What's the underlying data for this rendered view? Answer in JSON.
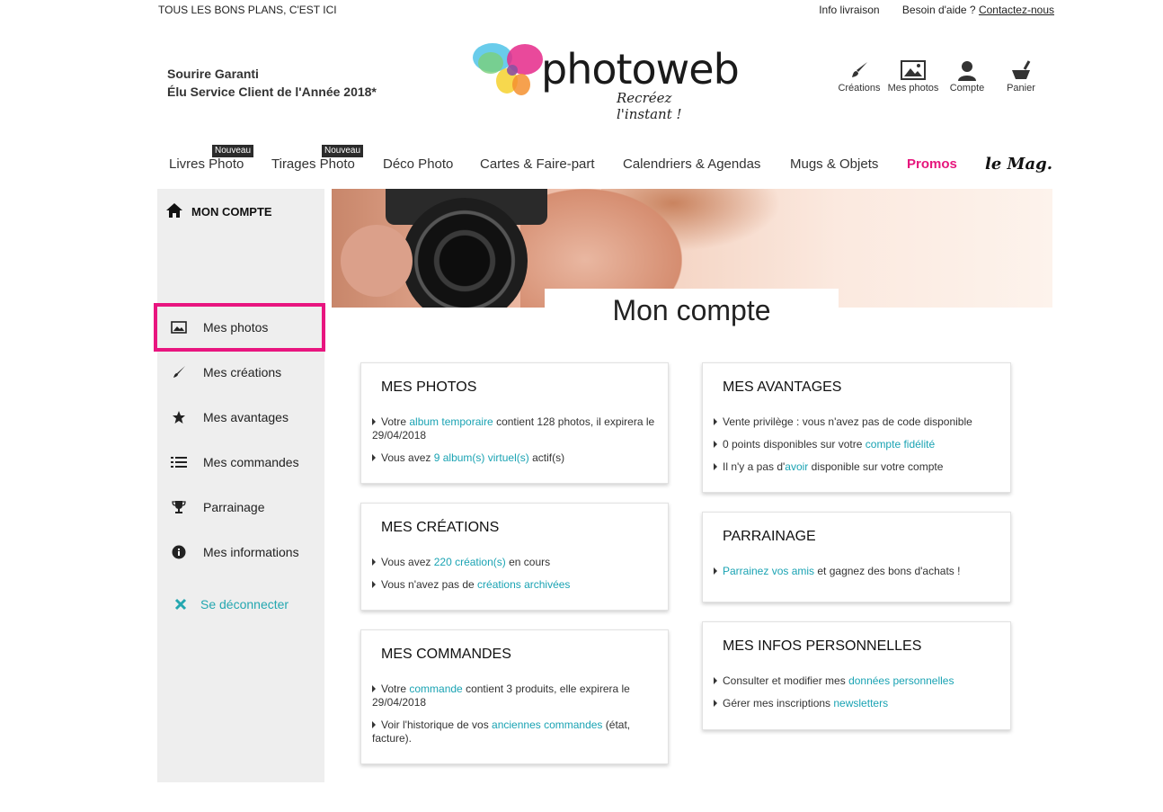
{
  "topbar": {
    "tagline": "TOUS LES BONS PLANS, C'EST ICI",
    "delivery_info": "Info livraison",
    "help_prefix": "Besoin d'aide ? ",
    "help_link": "Contactez-nous"
  },
  "header": {
    "sourire_line1": "Sourire Garanti",
    "sourire_line2": "Élu Service Client de l'Année 2018*",
    "logo_name": "photoweb",
    "logo_slogan": "Recréez l'instant !",
    "icons": [
      {
        "label": "Créations",
        "icon": "brush-icon"
      },
      {
        "label": "Mes photos",
        "icon": "picture-icon"
      },
      {
        "label": "Compte",
        "icon": "user-icon"
      },
      {
        "label": "Panier",
        "icon": "cart-icon"
      }
    ]
  },
  "nav": {
    "items": [
      {
        "label": "Livres Photo",
        "badge": "Nouveau"
      },
      {
        "label": "Tirages Photo",
        "badge": "Nouveau"
      },
      {
        "label": "Déco Photo"
      },
      {
        "label": "Cartes & Faire-part"
      },
      {
        "label": "Calendriers & Agendas"
      },
      {
        "label": "Mugs & Objets"
      },
      {
        "label": "Promos"
      },
      {
        "label": "le Mag."
      }
    ],
    "promo_color": "#e6177d"
  },
  "sidebar": {
    "title": "MON COMPTE",
    "items": [
      {
        "label": "Mes photos",
        "icon": "picture-icon"
      },
      {
        "label": "Mes créations",
        "icon": "brush-icon"
      },
      {
        "label": "Mes avantages",
        "icon": "star-icon"
      },
      {
        "label": "Mes commandes",
        "icon": "list-icon"
      },
      {
        "label": "Parrainage",
        "icon": "trophy-icon"
      },
      {
        "label": "Mes informations",
        "icon": "info-icon"
      }
    ],
    "logout": "Se déconnecter",
    "highlight_color": "#e8157f",
    "link_color": "#24a7b0"
  },
  "main": {
    "title": "Mon compte",
    "cards": {
      "photos": {
        "title": "MES PHOTOS",
        "l1_a": "Votre ",
        "l1_link": "album temporaire",
        "l1_b": " contient 128 photos, il expirera le 29/04/2018",
        "l2_a": "Vous avez ",
        "l2_link": "9 album(s) virtuel(s)",
        "l2_b": " actif(s)"
      },
      "creations": {
        "title": "MES CRÉATIONS",
        "l1_a": "Vous avez ",
        "l1_link": "220 création(s)",
        "l1_b": " en cours",
        "l2_a": "Vous n'avez pas de ",
        "l2_link": "créations archivées"
      },
      "commandes": {
        "title": "MES COMMANDES",
        "l1_a": "Votre ",
        "l1_link": "commande",
        "l1_b": " contient 3 produits, elle expirera le 29/04/2018",
        "l2_a": "Voir l'historique de vos ",
        "l2_link": "anciennes commandes",
        "l2_b": " (état, facture)."
      },
      "avantages": {
        "title": "MES AVANTAGES",
        "l1": "Vente privilège : vous n'avez pas de code disponible",
        "l2_a": "0 points disponibles sur votre ",
        "l2_link": "compte fidélité",
        "l3_a": "Il n'y a pas d'",
        "l3_link": "avoir",
        "l3_b": " disponible sur votre compte"
      },
      "parrainage": {
        "title": "PARRAINAGE",
        "l1_link": "Parrainez vos amis",
        "l1_b": " et gagnez des bons d'achats !"
      },
      "infos": {
        "title": "MES INFOS PERSONNELLES",
        "l1_a": "Consulter et modifier mes ",
        "l1_link": "données personnelles",
        "l2_a": "Gérer mes inscriptions ",
        "l2_link": "newsletters"
      }
    },
    "link_color": "#1aa3b3"
  }
}
